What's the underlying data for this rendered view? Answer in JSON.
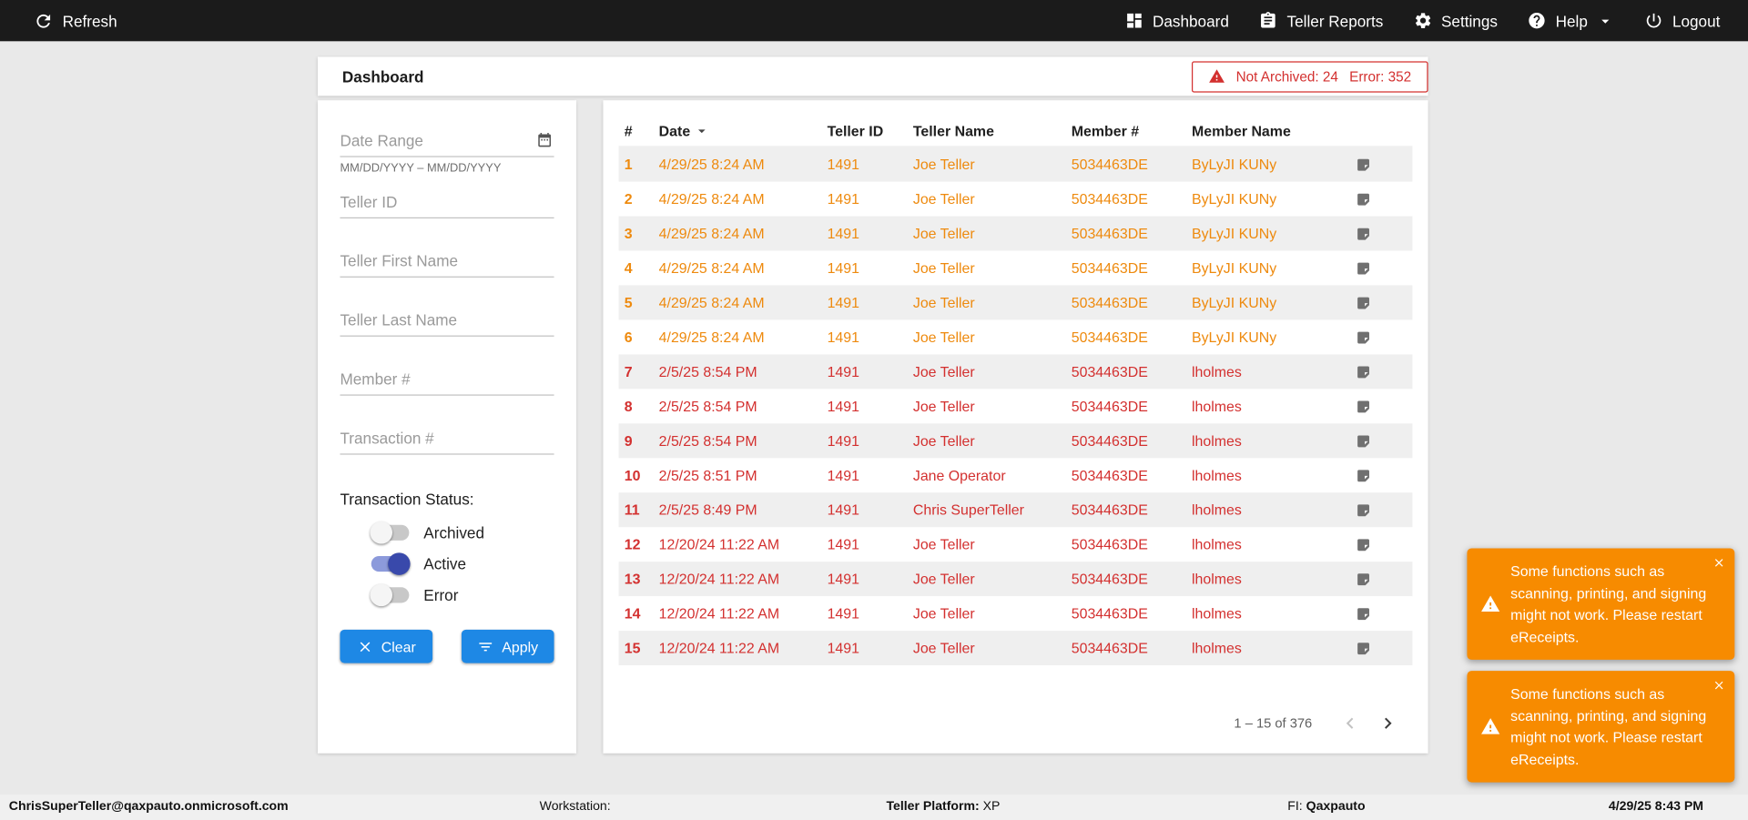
{
  "colors": {
    "warning_orange": "#ee8a0e",
    "error_red": "#d3302f",
    "accent_blue": "#1e88e5",
    "toast_orange": "#f78b00",
    "toggle_active_blue": "#3949ab",
    "topbar_black": "#1b1b1b"
  },
  "topnav": {
    "refresh_label": "Refresh",
    "dashboard_label": "Dashboard",
    "teller_reports_label": "Teller Reports",
    "settings_label": "Settings",
    "help_label": "Help",
    "logout_label": "Logout"
  },
  "header": {
    "title": "Dashboard",
    "alert": {
      "not_archived": "Not Archived: 24",
      "error": "Error: 352"
    }
  },
  "filters": {
    "date_range_placeholder": "Date Range",
    "date_range_helper": "MM/DD/YYYY – MM/DD/YYYY",
    "teller_id_placeholder": "Teller ID",
    "teller_first_name_placeholder": "Teller First Name",
    "teller_last_name_placeholder": "Teller Last Name",
    "member_placeholder": "Member #",
    "transaction_placeholder": "Transaction #",
    "status_label": "Transaction Status:",
    "toggles": [
      {
        "label": "Archived",
        "on": false
      },
      {
        "label": "Active",
        "on": true
      },
      {
        "label": "Error",
        "on": false
      }
    ],
    "clear_label": "Clear",
    "apply_label": "Apply"
  },
  "table": {
    "headers": {
      "num": "#",
      "date": "Date",
      "teller_id": "Teller ID",
      "teller_name": "Teller Name",
      "member_num": "Member #",
      "member_name": "Member Name"
    },
    "sort": {
      "column": "Date",
      "direction": "desc"
    },
    "rows": [
      {
        "num": "1",
        "date": "4/29/25 8:24 AM",
        "teller_id": "1491",
        "teller_name": "Joe Teller",
        "member_num": "5034463DE",
        "member_name": "ByLyJI KUNy",
        "status": "not-archived"
      },
      {
        "num": "2",
        "date": "4/29/25 8:24 AM",
        "teller_id": "1491",
        "teller_name": "Joe Teller",
        "member_num": "5034463DE",
        "member_name": "ByLyJI KUNy",
        "status": "not-archived"
      },
      {
        "num": "3",
        "date": "4/29/25 8:24 AM",
        "teller_id": "1491",
        "teller_name": "Joe Teller",
        "member_num": "5034463DE",
        "member_name": "ByLyJI KUNy",
        "status": "not-archived"
      },
      {
        "num": "4",
        "date": "4/29/25 8:24 AM",
        "teller_id": "1491",
        "teller_name": "Joe Teller",
        "member_num": "5034463DE",
        "member_name": "ByLyJI KUNy",
        "status": "not-archived"
      },
      {
        "num": "5",
        "date": "4/29/25 8:24 AM",
        "teller_id": "1491",
        "teller_name": "Joe Teller",
        "member_num": "5034463DE",
        "member_name": "ByLyJI KUNy",
        "status": "not-archived"
      },
      {
        "num": "6",
        "date": "4/29/25 8:24 AM",
        "teller_id": "1491",
        "teller_name": "Joe Teller",
        "member_num": "5034463DE",
        "member_name": "ByLyJI KUNy",
        "status": "not-archived"
      },
      {
        "num": "7",
        "date": "2/5/25 8:54 PM",
        "teller_id": "1491",
        "teller_name": "Joe Teller",
        "member_num": "5034463DE",
        "member_name": "lholmes",
        "status": "error"
      },
      {
        "num": "8",
        "date": "2/5/25 8:54 PM",
        "teller_id": "1491",
        "teller_name": "Joe Teller",
        "member_num": "5034463DE",
        "member_name": "lholmes",
        "status": "error"
      },
      {
        "num": "9",
        "date": "2/5/25 8:54 PM",
        "teller_id": "1491",
        "teller_name": "Joe Teller",
        "member_num": "5034463DE",
        "member_name": "lholmes",
        "status": "error"
      },
      {
        "num": "10",
        "date": "2/5/25 8:51 PM",
        "teller_id": "1491",
        "teller_name": "Jane Operator",
        "member_num": "5034463DE",
        "member_name": "lholmes",
        "status": "error"
      },
      {
        "num": "11",
        "date": "2/5/25 8:49 PM",
        "teller_id": "1491",
        "teller_name": "Chris SuperTeller",
        "member_num": "5034463DE",
        "member_name": "lholmes",
        "status": "error"
      },
      {
        "num": "12",
        "date": "12/20/24 11:22 AM",
        "teller_id": "1491",
        "teller_name": "Joe Teller",
        "member_num": "5034463DE",
        "member_name": "lholmes",
        "status": "error"
      },
      {
        "num": "13",
        "date": "12/20/24 11:22 AM",
        "teller_id": "1491",
        "teller_name": "Joe Teller",
        "member_num": "5034463DE",
        "member_name": "lholmes",
        "status": "error"
      },
      {
        "num": "14",
        "date": "12/20/24 11:22 AM",
        "teller_id": "1491",
        "teller_name": "Joe Teller",
        "member_num": "5034463DE",
        "member_name": "lholmes",
        "status": "error"
      },
      {
        "num": "15",
        "date": "12/20/24 11:22 AM",
        "teller_id": "1491",
        "teller_name": "Joe Teller",
        "member_num": "5034463DE",
        "member_name": "lholmes",
        "status": "error"
      }
    ],
    "pagination_range": "1 – 15 of 376"
  },
  "toasts": {
    "message1": "Some functions such as scanning, printing, and signing might not work. Please restart eReceipts.",
    "message2": "Some functions such as scanning, printing, and signing might not work. Please restart eReceipts."
  },
  "statusbar": {
    "user": "ChrisSuperTeller@qaxpauto.onmicrosoft.com",
    "workstation_label": "Workstation:",
    "platform_label": "Teller Platform:",
    "platform_value": "XP",
    "fi_label": "FI:",
    "fi_value": "Qaxpauto",
    "datetime": "4/29/25 8:43 PM"
  }
}
